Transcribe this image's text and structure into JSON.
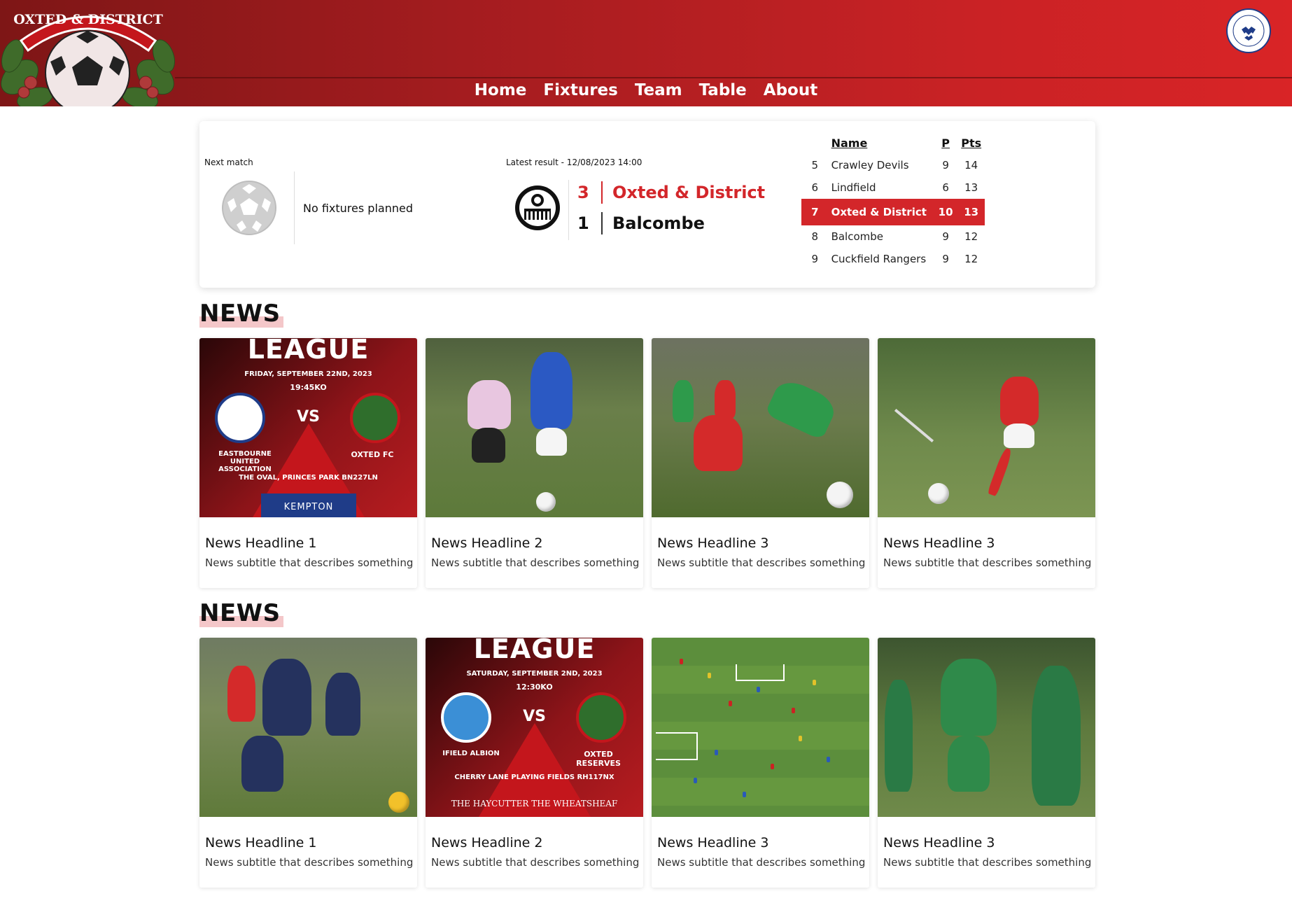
{
  "header": {
    "club_logo_text": "OXTED & DISTRICT",
    "league_badge_text": "MID SUSSEX FOOTBALL LEAGUE",
    "nav": [
      {
        "label": "Home"
      },
      {
        "label": "Fixtures"
      },
      {
        "label": "Team"
      },
      {
        "label": "Table"
      },
      {
        "label": "About"
      }
    ],
    "colors": {
      "primary": "#d3262a",
      "dark": "#7e1616"
    }
  },
  "next_match": {
    "label": "Next match",
    "text": "No fixtures planned"
  },
  "latest_result": {
    "label": "Latest result -  12/08/2023 14:00",
    "home": {
      "score": "3",
      "team": "Oxted & District"
    },
    "away": {
      "score": "1",
      "team": "Balcombe"
    }
  },
  "league_table": {
    "headers": {
      "name": "Name",
      "p": "P",
      "pts": "Pts"
    },
    "rows": [
      {
        "pos": "5",
        "name": "Crawley Devils",
        "p": "9",
        "pts": "14"
      },
      {
        "pos": "6",
        "name": "Lindfield",
        "p": "6",
        "pts": "13"
      },
      {
        "pos": "7",
        "name": "Oxted & District",
        "p": "10",
        "pts": "13"
      },
      {
        "pos": "8",
        "name": "Balcombe",
        "p": "9",
        "pts": "12"
      },
      {
        "pos": "9",
        "name": "Cuckfield Rangers",
        "p": "9",
        "pts": "12"
      }
    ]
  },
  "news_sections": [
    {
      "title": "NEWS",
      "cards": [
        {
          "title": "News Headline 1",
          "subtitle": "News subtitle that describes something"
        },
        {
          "title": "News Headline 2",
          "subtitle": "News subtitle that describes something"
        },
        {
          "title": "News Headline 3",
          "subtitle": "News subtitle that describes something"
        },
        {
          "title": "News Headline 3",
          "subtitle": "News subtitle that describes something"
        }
      ]
    },
    {
      "title": "NEWS",
      "cards": [
        {
          "title": "News Headline 1",
          "subtitle": "News subtitle that describes something"
        },
        {
          "title": "News Headline 2",
          "subtitle": "News subtitle that describes something"
        },
        {
          "title": "News Headline 3",
          "subtitle": "News subtitle that describes something"
        },
        {
          "title": "News Headline 3",
          "subtitle": "News subtitle that describes something"
        }
      ]
    }
  ],
  "posters": [
    {
      "title": "LEAGUE",
      "date": "FRIDAY, SEPTEMBER 22ND, 2023",
      "kickoff": "19:45KO",
      "vs": "VS",
      "home": "EASTBOURNE UNITED ASSOCIATION",
      "away": "OXTED FC",
      "venue": "THE OVAL, PRINCES PARK BN227LN",
      "sponsor": "KEMPTON"
    },
    {
      "title": "LEAGUE",
      "date": "SATURDAY, SEPTEMBER 2ND, 2023",
      "kickoff": "12:30KO",
      "vs": "VS",
      "home": "IFIELD ALBION",
      "away": "OXTED RESERVES",
      "venue": "CHERRY LANE PLAYING FIELDS RH117NX",
      "sponsor": "THE HAYCUTTER     THE WHEATSHEAF"
    }
  ]
}
